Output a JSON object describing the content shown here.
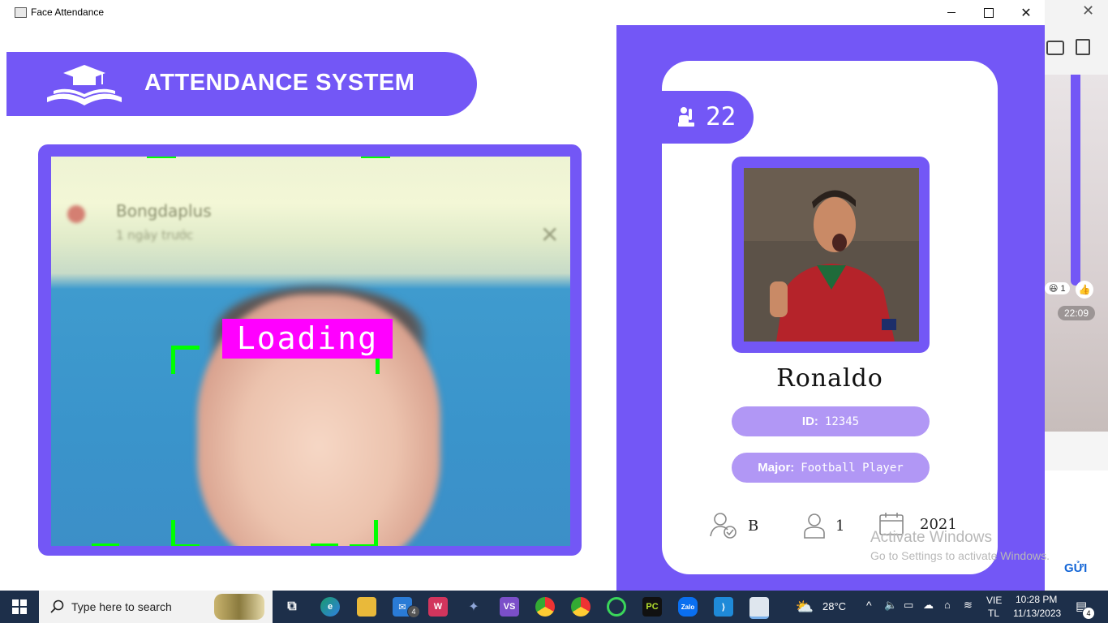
{
  "window": {
    "title": "Face Attendance"
  },
  "header": {
    "title": "ATTENDANCE SYSTEM",
    "icon": "graduation-book-icon"
  },
  "camera": {
    "overlay_label": "Loading",
    "blurred_text_1": "Bongdaplus",
    "blurred_text_2": "1 ngày trước",
    "box_color": "#00ff00",
    "label_bg": "#ff00ff"
  },
  "student": {
    "total_attendance": "22",
    "name": "Ronaldo",
    "id_label": "ID:",
    "id_value": "12345",
    "major_label": "Major:",
    "major_value": "Football Player",
    "standing": "B",
    "year": "1",
    "starting_year": "2021"
  },
  "background_app": {
    "time_badge": "22:09",
    "reaction_count": "1",
    "send_label": "GỬI"
  },
  "activation": {
    "title": "Activate Windows",
    "subtitle": "Go to Settings to activate Windows."
  },
  "taskbar": {
    "search_placeholder": "Type here to search",
    "mail_badge": "4",
    "weather": "28°C",
    "lang_top": "VIE",
    "lang_bottom": "TL",
    "time": "10:28 PM",
    "date": "11/13/2023",
    "notification_count": "4"
  },
  "colors": {
    "accent": "#7357f6",
    "pill": "#b197f5",
    "taskbar": "#1d2f4a"
  }
}
